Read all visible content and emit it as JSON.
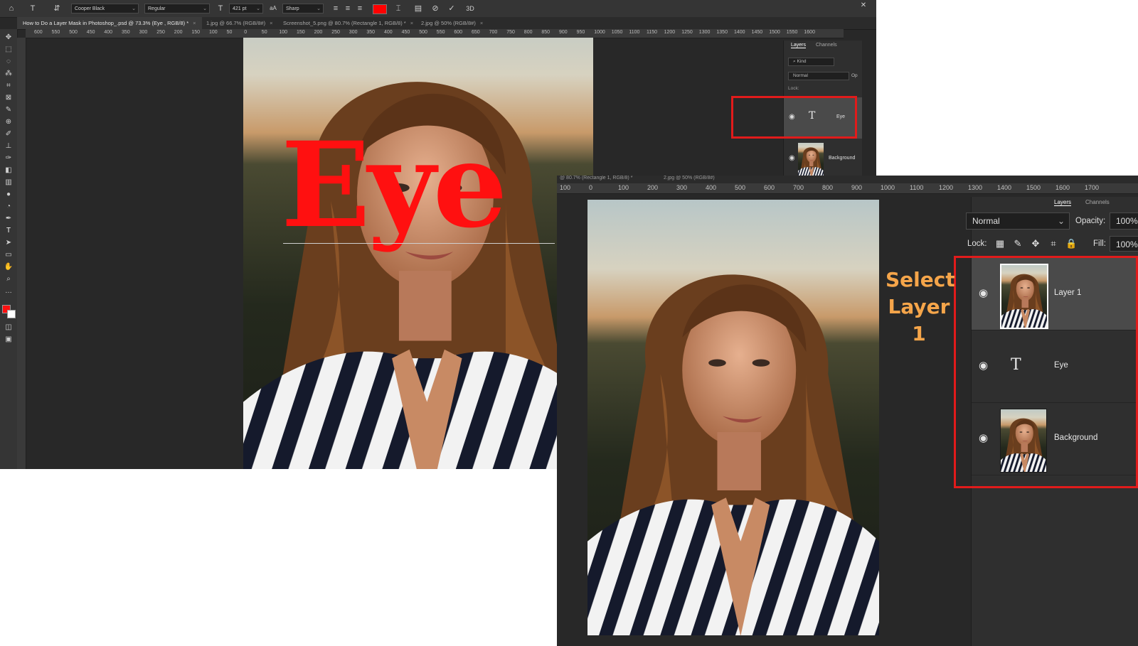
{
  "options_bar": {
    "font_family": "Cooper Black",
    "font_style": "Regular",
    "font_size": "421 pt",
    "anti_alias": "Sharp",
    "text_color": "#ff0000",
    "icons": [
      "home-icon",
      "text-tool-icon",
      "text-orientation-icon",
      "font-size-icon",
      "anti-alias-icon",
      "align-left-icon",
      "align-center-icon",
      "align-right-icon",
      "warp-text-icon",
      "character-panel-icon",
      "cancel-icon",
      "commit-icon",
      "3d-icon"
    ]
  },
  "tabs_top": [
    {
      "label": "How to Do a Layer Mask in Photoshop_.psd @ 73.3% (Eye , RGB/8) *",
      "active": true
    },
    {
      "label": "1.jpg @ 66.7% (RGB/8#)"
    },
    {
      "label": "Screenshot_5.png @ 80.7% (Rectangle 1, RGB/8) *"
    },
    {
      "label": "2.jpg @ 50% (RGB/8#)"
    }
  ],
  "tabs_bottom": [
    {
      "label": "@ 80.7% (Rectangle 1, RGB/8) *"
    },
    {
      "label": "2.jpg @ 50% (RGB/8#)"
    }
  ],
  "ruler_top": [
    "600",
    "550",
    "500",
    "450",
    "400",
    "350",
    "300",
    "250",
    "200",
    "150",
    "100",
    "50",
    "0",
    "50",
    "100",
    "150",
    "200",
    "250",
    "300",
    "350",
    "400",
    "450",
    "500",
    "550",
    "600",
    "650",
    "700",
    "750",
    "800",
    "850",
    "900",
    "950",
    "1000",
    "1050",
    "1100",
    "1150",
    "1200",
    "1250",
    "1300",
    "1350",
    "1400",
    "1450",
    "1500",
    "1550",
    "1600"
  ],
  "ruler_bottom": [
    "100",
    "0",
    "100",
    "200",
    "300",
    "400",
    "500",
    "600",
    "700",
    "800",
    "900",
    "1000",
    "1100",
    "1200",
    "1300",
    "1400",
    "1500",
    "1600",
    "1700"
  ],
  "canvas_text": "Eye",
  "layers_small": {
    "tabs": [
      "Layers",
      "Channels"
    ],
    "filter": "Kind",
    "blend": "Normal",
    "opacity_label": "Op",
    "lock_label": "Lock:",
    "layers": [
      {
        "name": "Eye",
        "type": "text"
      },
      {
        "name": "Background",
        "type": "image"
      }
    ]
  },
  "layers_large": {
    "tabs": [
      "Layers",
      "Channels"
    ],
    "blend": "Normal",
    "opacity_label": "Opacity:",
    "opacity_value": "100%",
    "lock_label": "Lock:",
    "fill_label": "Fill:",
    "fill_value": "100%",
    "layers": [
      {
        "name": "Layer 1",
        "type": "image",
        "selected": true
      },
      {
        "name": "Eye",
        "type": "text"
      },
      {
        "name": "Background",
        "type": "image"
      }
    ]
  },
  "annotation": {
    "line1": "Select",
    "line2": "Layer 1"
  },
  "colors": {
    "highlight": "#e11b1b",
    "annotation": "#f5a54a",
    "panel": "#2f2f2f",
    "canvas_bg": "#282828"
  }
}
